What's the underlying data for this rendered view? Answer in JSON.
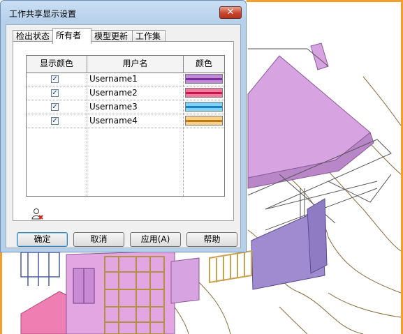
{
  "dialog": {
    "title": "工作共享显示设置",
    "close_label": "✕",
    "tabs": [
      {
        "label": "检出状态",
        "active": false
      },
      {
        "label": "所有者",
        "active": true
      },
      {
        "label": "模型更新",
        "active": false
      },
      {
        "label": "工作集",
        "active": false
      }
    ],
    "table": {
      "headers": [
        "显示颜色",
        "用户名",
        "颜色"
      ],
      "rows": [
        {
          "checked": true,
          "username": "Username1",
          "color": "#c08ad6",
          "line": "#7a2f9c"
        },
        {
          "checked": true,
          "username": "Username2",
          "color": "#f27a9c",
          "line": "#c8174c"
        },
        {
          "checked": true,
          "username": "Username3",
          "color": "#7fd3f7",
          "line": "#1e7fc1"
        },
        {
          "checked": true,
          "username": "Username4",
          "color": "#f8d08a",
          "line": "#c07c12"
        }
      ]
    },
    "remove_user_icon": "user-remove-icon",
    "buttons": {
      "ok": "确定",
      "cancel": "取消",
      "apply": "应用(A)",
      "help": "帮助"
    }
  },
  "check_mark": "✓",
  "colors": {
    "viewport_accent": "#f0a030",
    "purple_slab": "#d7a3e0",
    "pink_slab": "#ef7fb3",
    "wood": "#e6c97a"
  }
}
